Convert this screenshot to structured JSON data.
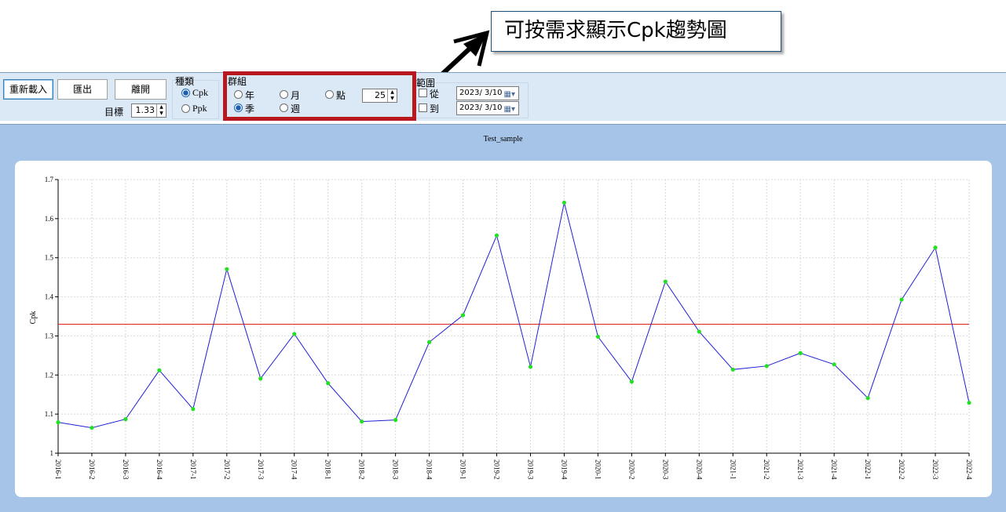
{
  "callout": {
    "text": "可按需求顯示Cpk趨勢圖"
  },
  "toolbar": {
    "reload_label": "重新載入",
    "export_label": "匯出",
    "exit_label": "離開",
    "target_label": "目標",
    "target_value": "1.33",
    "type_group_label": "種類",
    "type_options": [
      "Cpk",
      "Ppk"
    ],
    "type_selected": "Cpk",
    "group_label": "群組",
    "group_options": [
      "年",
      "月",
      "點",
      "季",
      "週"
    ],
    "group_selected": "季",
    "points_value": "25",
    "range_label": "範圍",
    "from_label": "從",
    "from_date": "2023/ 3/10",
    "to_label": "到",
    "to_date": "2023/ 3/10"
  },
  "chart_data": {
    "type": "line",
    "title": "Test_sample",
    "xlabel": "",
    "ylabel": "Cpk",
    "ylim": [
      1,
      1.7
    ],
    "yticks": [
      "1",
      "1.1",
      "1.2",
      "1.3",
      "1.4",
      "1.5",
      "1.6",
      "1.7"
    ],
    "target_line": 1.33,
    "grid": true,
    "line_color": "#1f1fd6",
    "marker_color": "#22e022",
    "target_color": "#e02020",
    "categories": [
      "2016-1",
      "2016-2",
      "2016-3",
      "2016-4",
      "2017-1",
      "2017-2",
      "2017-3",
      "2017-4",
      "2018-1",
      "2018-2",
      "2018-3",
      "2018-4",
      "2019-1",
      "2019-2",
      "2019-3",
      "2019-4",
      "2020-1",
      "2020-2",
      "2020-3",
      "2020-4",
      "2021-1",
      "2021-2",
      "2021-3",
      "2021-4",
      "2022-1",
      "2022-2",
      "2022-3",
      "2022-4"
    ],
    "values": [
      1.079,
      1.065,
      1.087,
      1.212,
      1.113,
      1.471,
      1.191,
      1.305,
      1.179,
      1.081,
      1.085,
      1.284,
      1.353,
      1.557,
      1.221,
      1.641,
      1.298,
      1.183,
      1.439,
      1.311,
      1.214,
      1.223,
      1.256,
      1.227,
      1.141,
      1.393,
      1.526,
      1.129
    ]
  }
}
